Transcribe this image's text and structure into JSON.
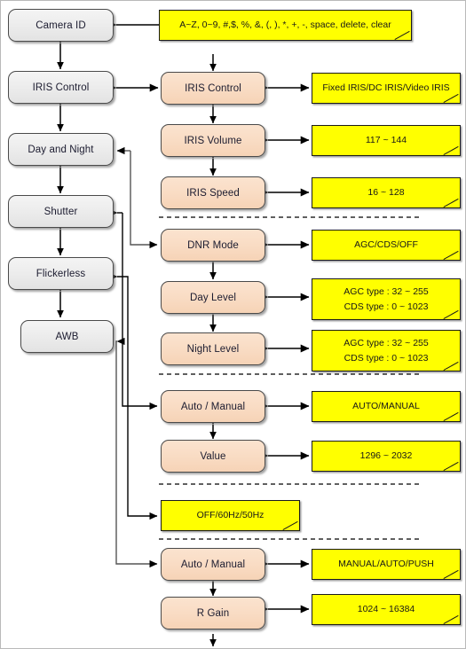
{
  "diagram": {
    "title": "Camera OSD Menu Tree",
    "colors": {
      "note_fill": "#FFFF00",
      "sub_node_fill": "#F9DCC4",
      "menu_node_fill": "#EDEDED",
      "line": "#000000",
      "border": "#4A4A4A"
    }
  },
  "main_menu": [
    {
      "id": "camera-id",
      "label": "Camera ID"
    },
    {
      "id": "iris-control",
      "label": "IRIS Control"
    },
    {
      "id": "day-night",
      "label": "Day and Night"
    },
    {
      "id": "shutter",
      "label": "Shutter"
    },
    {
      "id": "flickerless",
      "label": "Flickerless"
    },
    {
      "id": "awb",
      "label": "AWB"
    }
  ],
  "sub_menu": [
    {
      "id": "iris-control-sub",
      "label": "IRIS Control"
    },
    {
      "id": "iris-volume",
      "label": "IRIS Volume"
    },
    {
      "id": "iris-speed",
      "label": "IRIS Speed"
    },
    {
      "id": "dnr-mode",
      "label": "DNR Mode"
    },
    {
      "id": "day-level",
      "label": "Day Level"
    },
    {
      "id": "night-level",
      "label": "Night Level"
    },
    {
      "id": "shutter-auto-manual",
      "label": "Auto / Manual"
    },
    {
      "id": "shutter-value",
      "label": "Value"
    },
    {
      "id": "awb-auto-manual",
      "label": "Auto / Manual"
    },
    {
      "id": "r-gain",
      "label": "R Gain"
    }
  ],
  "notes": [
    {
      "id": "camera-id-values",
      "lines": [
        "A~Z, 0~9, #,$, %, &, (, ), *, +, -, space, delete, clear"
      ]
    },
    {
      "id": "iris-control-values",
      "lines": [
        "Fixed IRIS/DC IRIS/Video IRIS"
      ]
    },
    {
      "id": "iris-volume-values",
      "lines": [
        "117 ~ 144"
      ]
    },
    {
      "id": "iris-speed-values",
      "lines": [
        "16 ~ 128"
      ]
    },
    {
      "id": "dnr-mode-values",
      "lines": [
        "AGC/CDS/OFF"
      ]
    },
    {
      "id": "day-level-values",
      "lines": [
        "AGC type : 32 ~ 255",
        "CDS type : 0 ~ 1023"
      ]
    },
    {
      "id": "night-level-values",
      "lines": [
        "AGC type : 32 ~ 255",
        "CDS type : 0 ~ 1023"
      ]
    },
    {
      "id": "shutter-mode-values",
      "lines": [
        "AUTO/MANUAL"
      ]
    },
    {
      "id": "shutter-value-values",
      "lines": [
        "1296 ~ 2032"
      ]
    },
    {
      "id": "flickerless-values",
      "lines": [
        "OFF/60Hz/50Hz"
      ]
    },
    {
      "id": "awb-mode-values",
      "lines": [
        "MANUAL/AUTO/PUSH"
      ]
    },
    {
      "id": "r-gain-values",
      "lines": [
        "1024 ~ 16384"
      ]
    }
  ]
}
